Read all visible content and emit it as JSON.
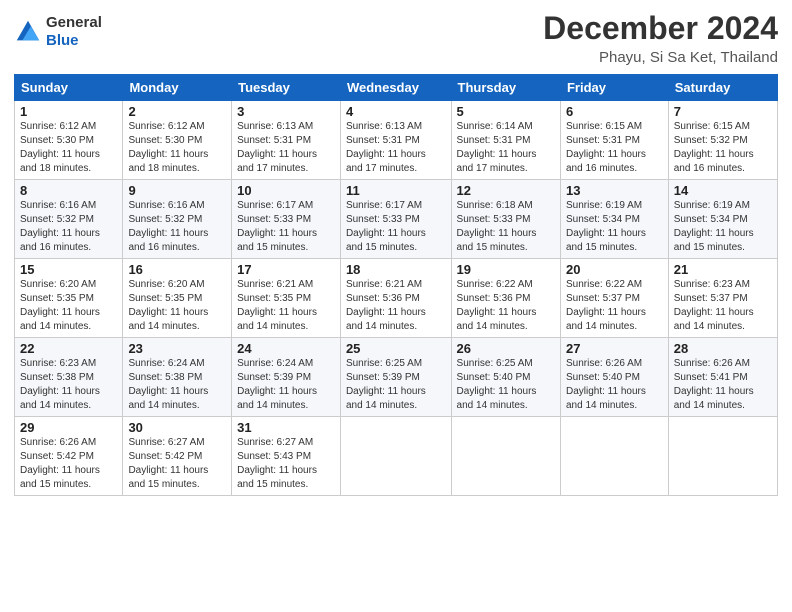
{
  "header": {
    "logo_line1": "General",
    "logo_line2": "Blue",
    "title": "December 2024",
    "subtitle": "Phayu, Si Sa Ket, Thailand"
  },
  "calendar": {
    "weekdays": [
      "Sunday",
      "Monday",
      "Tuesday",
      "Wednesday",
      "Thursday",
      "Friday",
      "Saturday"
    ],
    "weeks": [
      [
        {
          "day": "1",
          "info": "Sunrise: 6:12 AM\nSunset: 5:30 PM\nDaylight: 11 hours\nand 18 minutes."
        },
        {
          "day": "2",
          "info": "Sunrise: 6:12 AM\nSunset: 5:30 PM\nDaylight: 11 hours\nand 18 minutes."
        },
        {
          "day": "3",
          "info": "Sunrise: 6:13 AM\nSunset: 5:31 PM\nDaylight: 11 hours\nand 17 minutes."
        },
        {
          "day": "4",
          "info": "Sunrise: 6:13 AM\nSunset: 5:31 PM\nDaylight: 11 hours\nand 17 minutes."
        },
        {
          "day": "5",
          "info": "Sunrise: 6:14 AM\nSunset: 5:31 PM\nDaylight: 11 hours\nand 17 minutes."
        },
        {
          "day": "6",
          "info": "Sunrise: 6:15 AM\nSunset: 5:31 PM\nDaylight: 11 hours\nand 16 minutes."
        },
        {
          "day": "7",
          "info": "Sunrise: 6:15 AM\nSunset: 5:32 PM\nDaylight: 11 hours\nand 16 minutes."
        }
      ],
      [
        {
          "day": "8",
          "info": "Sunrise: 6:16 AM\nSunset: 5:32 PM\nDaylight: 11 hours\nand 16 minutes."
        },
        {
          "day": "9",
          "info": "Sunrise: 6:16 AM\nSunset: 5:32 PM\nDaylight: 11 hours\nand 16 minutes."
        },
        {
          "day": "10",
          "info": "Sunrise: 6:17 AM\nSunset: 5:33 PM\nDaylight: 11 hours\nand 15 minutes."
        },
        {
          "day": "11",
          "info": "Sunrise: 6:17 AM\nSunset: 5:33 PM\nDaylight: 11 hours\nand 15 minutes."
        },
        {
          "day": "12",
          "info": "Sunrise: 6:18 AM\nSunset: 5:33 PM\nDaylight: 11 hours\nand 15 minutes."
        },
        {
          "day": "13",
          "info": "Sunrise: 6:19 AM\nSunset: 5:34 PM\nDaylight: 11 hours\nand 15 minutes."
        },
        {
          "day": "14",
          "info": "Sunrise: 6:19 AM\nSunset: 5:34 PM\nDaylight: 11 hours\nand 15 minutes."
        }
      ],
      [
        {
          "day": "15",
          "info": "Sunrise: 6:20 AM\nSunset: 5:35 PM\nDaylight: 11 hours\nand 14 minutes."
        },
        {
          "day": "16",
          "info": "Sunrise: 6:20 AM\nSunset: 5:35 PM\nDaylight: 11 hours\nand 14 minutes."
        },
        {
          "day": "17",
          "info": "Sunrise: 6:21 AM\nSunset: 5:35 PM\nDaylight: 11 hours\nand 14 minutes."
        },
        {
          "day": "18",
          "info": "Sunrise: 6:21 AM\nSunset: 5:36 PM\nDaylight: 11 hours\nand 14 minutes."
        },
        {
          "day": "19",
          "info": "Sunrise: 6:22 AM\nSunset: 5:36 PM\nDaylight: 11 hours\nand 14 minutes."
        },
        {
          "day": "20",
          "info": "Sunrise: 6:22 AM\nSunset: 5:37 PM\nDaylight: 11 hours\nand 14 minutes."
        },
        {
          "day": "21",
          "info": "Sunrise: 6:23 AM\nSunset: 5:37 PM\nDaylight: 11 hours\nand 14 minutes."
        }
      ],
      [
        {
          "day": "22",
          "info": "Sunrise: 6:23 AM\nSunset: 5:38 PM\nDaylight: 11 hours\nand 14 minutes."
        },
        {
          "day": "23",
          "info": "Sunrise: 6:24 AM\nSunset: 5:38 PM\nDaylight: 11 hours\nand 14 minutes."
        },
        {
          "day": "24",
          "info": "Sunrise: 6:24 AM\nSunset: 5:39 PM\nDaylight: 11 hours\nand 14 minutes."
        },
        {
          "day": "25",
          "info": "Sunrise: 6:25 AM\nSunset: 5:39 PM\nDaylight: 11 hours\nand 14 minutes."
        },
        {
          "day": "26",
          "info": "Sunrise: 6:25 AM\nSunset: 5:40 PM\nDaylight: 11 hours\nand 14 minutes."
        },
        {
          "day": "27",
          "info": "Sunrise: 6:26 AM\nSunset: 5:40 PM\nDaylight: 11 hours\nand 14 minutes."
        },
        {
          "day": "28",
          "info": "Sunrise: 6:26 AM\nSunset: 5:41 PM\nDaylight: 11 hours\nand 14 minutes."
        }
      ],
      [
        {
          "day": "29",
          "info": "Sunrise: 6:26 AM\nSunset: 5:42 PM\nDaylight: 11 hours\nand 15 minutes."
        },
        {
          "day": "30",
          "info": "Sunrise: 6:27 AM\nSunset: 5:42 PM\nDaylight: 11 hours\nand 15 minutes."
        },
        {
          "day": "31",
          "info": "Sunrise: 6:27 AM\nSunset: 5:43 PM\nDaylight: 11 hours\nand 15 minutes."
        },
        {
          "day": "",
          "info": ""
        },
        {
          "day": "",
          "info": ""
        },
        {
          "day": "",
          "info": ""
        },
        {
          "day": "",
          "info": ""
        }
      ]
    ]
  }
}
